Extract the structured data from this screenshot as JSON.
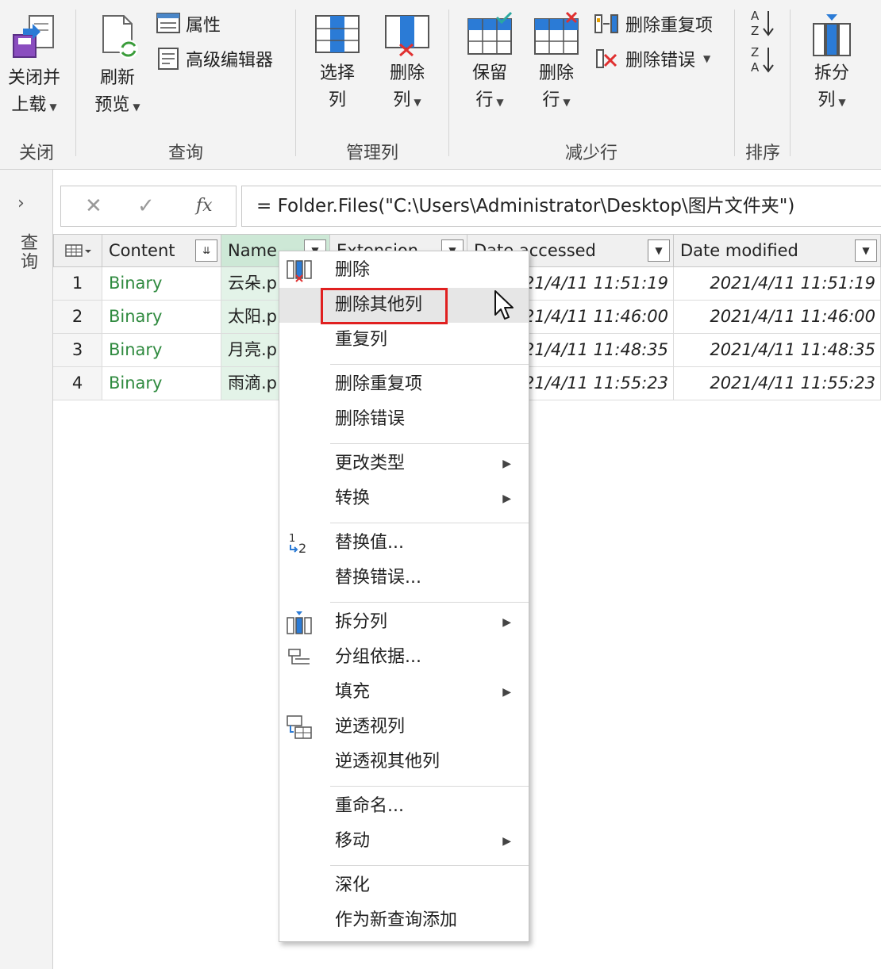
{
  "ribbon": {
    "close_group": {
      "btn_line1": "关闭并",
      "btn_line2": "上载",
      "label": "关闭"
    },
    "query_group": {
      "refresh_line1": "刷新",
      "refresh_line2": "预览",
      "properties": "属性",
      "advanced_editor": "高级编辑器",
      "label": "查询"
    },
    "manage_cols_group": {
      "choose_line1": "选择",
      "choose_line2": "列",
      "remove_line1": "删除",
      "remove_line2": "列",
      "label": "管理列"
    },
    "reduce_rows_group": {
      "keep_line1": "保留",
      "keep_line2": "行",
      "remove_line1": "删除",
      "remove_line2": "行",
      "remove_duplicates": "删除重复项",
      "remove_errors": "删除错误",
      "label": "减少行"
    },
    "sort_group": {
      "label": "排序"
    },
    "split_group": {
      "line1": "拆分",
      "line2": "列"
    }
  },
  "left_pane": {
    "label": "查询"
  },
  "formula_bar": {
    "fx": "fx",
    "formula": "= Folder.Files(\"C:\\Users\\Administrator\\Desktop\\图片文件夹\")"
  },
  "table": {
    "columns": [
      "Content",
      "Name",
      "Extension",
      "Date accessed",
      "Date modified"
    ],
    "rows": [
      {
        "n": "1",
        "content": "Binary",
        "name": "云朵.p",
        "accessed": "2021/4/11 11:51:19",
        "modified": "2021/4/11 11:51:19"
      },
      {
        "n": "2",
        "content": "Binary",
        "name": "太阳.p",
        "accessed": "2021/4/11 11:46:00",
        "modified": "2021/4/11 11:46:00"
      },
      {
        "n": "3",
        "content": "Binary",
        "name": "月亮.p",
        "accessed": "2021/4/11 11:48:35",
        "modified": "2021/4/11 11:48:35"
      },
      {
        "n": "4",
        "content": "Binary",
        "name": "雨滴.p",
        "accessed": "2021/4/11 11:55:23",
        "modified": "2021/4/11 11:55:23"
      }
    ]
  },
  "context_menu": {
    "items": [
      {
        "label": "删除"
      },
      {
        "label": "删除其他列"
      },
      {
        "label": "重复列"
      },
      {
        "label": "删除重复项"
      },
      {
        "label": "删除错误"
      },
      {
        "label": "更改类型"
      },
      {
        "label": "转换"
      },
      {
        "label": "替换值..."
      },
      {
        "label": "替换错误..."
      },
      {
        "label": "拆分列"
      },
      {
        "label": "分组依据..."
      },
      {
        "label": "填充"
      },
      {
        "label": "逆透视列"
      },
      {
        "label": "逆透视其他列"
      },
      {
        "label": "重命名..."
      },
      {
        "label": "移动"
      },
      {
        "label": "深化"
      },
      {
        "label": "作为新查询添加"
      }
    ]
  },
  "colors": {
    "highlight_box": "#e02020",
    "selected_column": "#cde8d6",
    "binary_text": "#2f8a3f"
  }
}
